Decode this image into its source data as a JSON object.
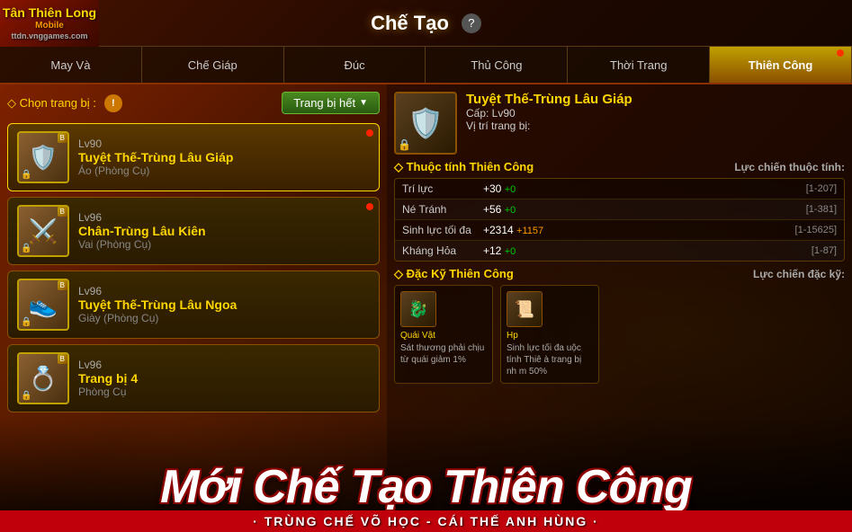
{
  "title": "Chế Tạo",
  "help_label": "?",
  "logo": {
    "line1": "Tân Thiên Long",
    "line2": "Mobile",
    "site": "ttdn.vnggames.com"
  },
  "tabs": [
    {
      "id": "may-va",
      "label": "May Và",
      "active": false,
      "badge": false
    },
    {
      "id": "che-giap",
      "label": "Chế Giáp",
      "active": false,
      "badge": false
    },
    {
      "id": "duc",
      "label": "Đúc",
      "active": false,
      "badge": false
    },
    {
      "id": "thu-cong",
      "label": "Thủ Công",
      "active": false,
      "badge": false
    },
    {
      "id": "thoi-trang",
      "label": "Thời Trang",
      "active": false,
      "badge": false
    },
    {
      "id": "thien-cong",
      "label": "Thiên Công",
      "active": true,
      "badge": true
    }
  ],
  "left_panel": {
    "select_label": "◇ Chọn trang bị :",
    "warning_icon": "!",
    "dropdown_label": "Trang bị hết",
    "items": [
      {
        "id": "item1",
        "selected": true,
        "level": "Lv90",
        "name": "Tuyệt Thế-Trùng Lâu Giáp",
        "sub": "Áo (Phòng Cụ)",
        "icon": "🛡️",
        "badge": "B",
        "has_dot": true
      },
      {
        "id": "item2",
        "selected": false,
        "level": "Lv96",
        "name": "Chân-Trùng Lâu Kiên",
        "sub": "Vai (Phòng Cụ)",
        "icon": "⚔️",
        "badge": "B",
        "has_dot": true
      },
      {
        "id": "item3",
        "selected": false,
        "level": "Lv96",
        "name": "Tuyệt Thế-Trùng Lâu Ngoa",
        "sub": "Giày (Phòng Cụ)",
        "icon": "👟",
        "badge": "B",
        "has_dot": false
      },
      {
        "id": "item4",
        "selected": false,
        "level": "Lv96",
        "name": "Trang bị 4",
        "sub": "Phòng Cụ",
        "icon": "💍",
        "badge": "B",
        "has_dot": false
      }
    ]
  },
  "right_panel": {
    "item_name": "Tuyệt Thế-Trùng Lâu Giáp",
    "item_level": "Cấp: Lv90",
    "item_pos": "Vị trí trang bị:",
    "attr_title": "◇ Thuộc tính Thiên Công",
    "attr_sub": "Lực chiến thuộc tính:",
    "stats": [
      {
        "name": "Trí lực",
        "value": "+30",
        "bonus": "+0",
        "range": "[1-207]"
      },
      {
        "name": "Né Tránh",
        "value": "+56",
        "bonus": "+0",
        "range": "[1-381]"
      },
      {
        "name": "Sinh lực tối đa",
        "value": "+2314",
        "bonus": "+1157",
        "range": "[1-15625]"
      },
      {
        "name": "Kháng Hỏa",
        "value": "+12",
        "bonus": "+0",
        "range": "[1-87]"
      }
    ],
    "skill_title": "◇ Đặc Kỹ Thiên Công",
    "skill_sub": "Lực chiến đặc kỹ:",
    "skills": [
      {
        "icon": "🐉",
        "label": "Quái Vật",
        "desc": "Sát thương phải chịu từ quái giảm 1%"
      },
      {
        "icon": "📜",
        "label": "Hp",
        "desc": "Sinh lực tối đa uộc tính Thiê à trang bị nh m 50%"
      }
    ]
  },
  "banner": {
    "title": "Mới Chế Tạo Thiên Công",
    "subtitle": "· TRÙNG CHẾ VÕ HỌC - CÁI THẾ ANH HÙNG ·"
  }
}
